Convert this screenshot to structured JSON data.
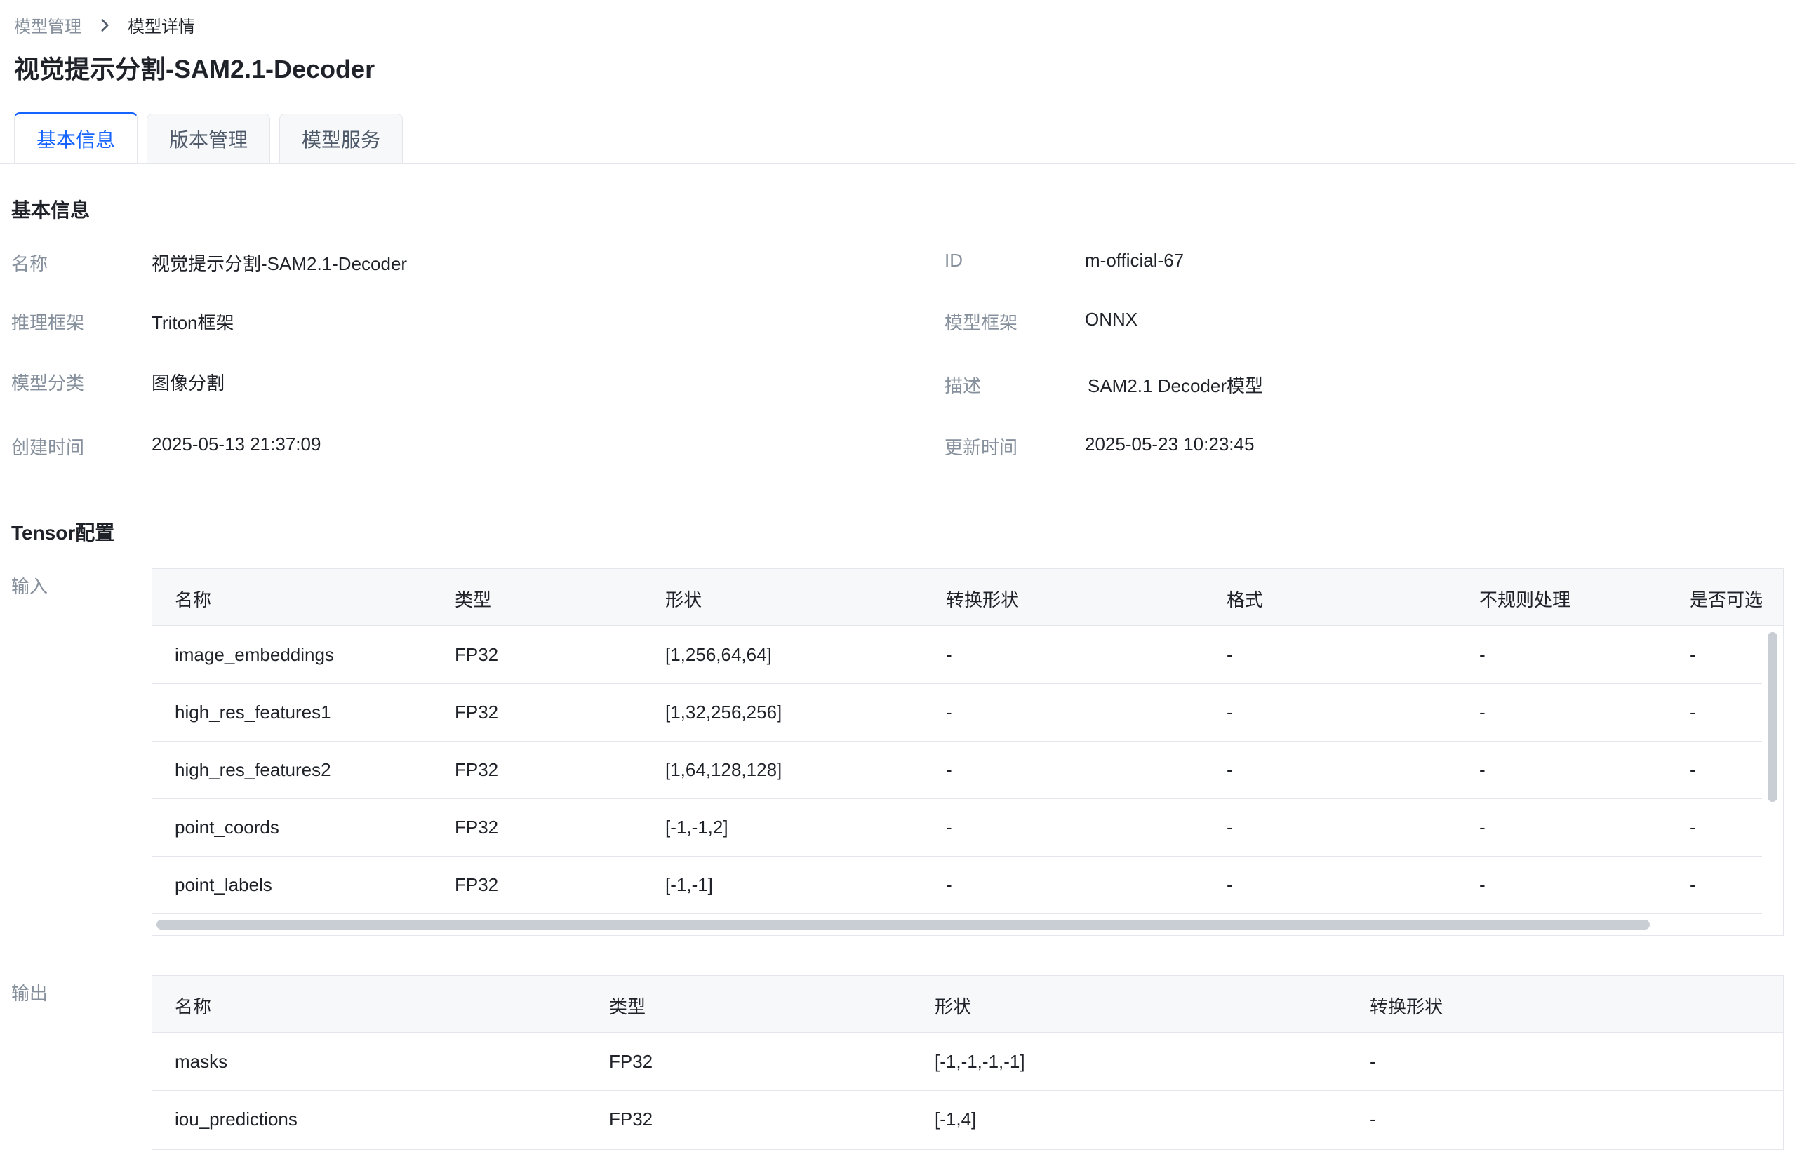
{
  "breadcrumb": {
    "parent": "模型管理",
    "current": "模型详情"
  },
  "page_title": "视觉提示分割-SAM2.1-Decoder",
  "tabs": [
    {
      "label": "基本信息",
      "active": true
    },
    {
      "label": "版本管理",
      "active": false
    },
    {
      "label": "模型服务",
      "active": false
    }
  ],
  "basic_info": {
    "title": "基本信息",
    "fields": {
      "name_label": "名称",
      "name_value": "视觉提示分割-SAM2.1-Decoder",
      "id_label": "ID",
      "id_value": "m-official-67",
      "infer_label": "推理框架",
      "infer_value": "Triton框架",
      "framework_label": "模型框架",
      "framework_value": "ONNX",
      "category_label": "模型分类",
      "category_value": "图像分割",
      "desc_label": "描述",
      "desc_value": "SAM2.1 Decoder模型",
      "created_label": "创建时间",
      "created_value": "2025-05-13 21:37:09",
      "updated_label": "更新时间",
      "updated_value": "2025-05-23 10:23:45"
    }
  },
  "tensor": {
    "title": "Tensor配置",
    "input_label": "输入",
    "input_columns": [
      "名称",
      "类型",
      "形状",
      "转换形状",
      "格式",
      "不规则处理",
      "是否可选"
    ],
    "input_rows": [
      [
        "image_embeddings",
        "FP32",
        "[1,256,64,64]",
        "-",
        "-",
        "-",
        "-"
      ],
      [
        "high_res_features1",
        "FP32",
        "[1,32,256,256]",
        "-",
        "-",
        "-",
        "-"
      ],
      [
        "high_res_features2",
        "FP32",
        "[1,64,128,128]",
        "-",
        "-",
        "-",
        "-"
      ],
      [
        "point_coords",
        "FP32",
        "[-1,-1,2]",
        "-",
        "-",
        "-",
        "-"
      ],
      [
        "point_labels",
        "FP32",
        "[-1,-1]",
        "-",
        "-",
        "-",
        "-"
      ]
    ],
    "output_label": "输出",
    "output_columns": [
      "名称",
      "类型",
      "形状",
      "转换形状"
    ],
    "output_rows": [
      [
        "masks",
        "FP32",
        "[-1,-1,-1,-1]",
        "-"
      ],
      [
        "iou_predictions",
        "FP32",
        "[-1,4]",
        "-"
      ]
    ]
  },
  "colors": {
    "accent": "#1664ff",
    "muted_text": "#86909c",
    "border": "#e5e6eb",
    "header_bg": "#f7f8fa"
  },
  "icons": {
    "breadcrumb_separator": "chevron-right-icon"
  }
}
